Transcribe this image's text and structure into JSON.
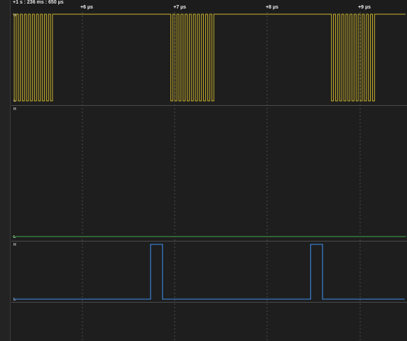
{
  "time_ruler": {
    "origin_label": "+1 s : 236 ms : 650 µs",
    "ticks": [
      "+6 µs",
      "+7 µs",
      "+8 µs",
      "+9 µs"
    ]
  },
  "channels": [
    {
      "id": "ch0",
      "high_label": "H",
      "low_label": "L",
      "color": "#c9b12e",
      "waveform": "burst-clock-high-idle",
      "bursts": 3
    },
    {
      "id": "ch1",
      "high_label": "H",
      "low_label": "L",
      "color": "#3da544",
      "waveform": "constant-low"
    },
    {
      "id": "ch2",
      "high_label": "H",
      "low_label": "L",
      "color": "#3a83d6",
      "waveform": "pulses",
      "pulse_count": 2
    }
  ],
  "colors": {
    "background": "#1e1e1e",
    "grid": "#555555",
    "divider": "#4a4a4a"
  }
}
